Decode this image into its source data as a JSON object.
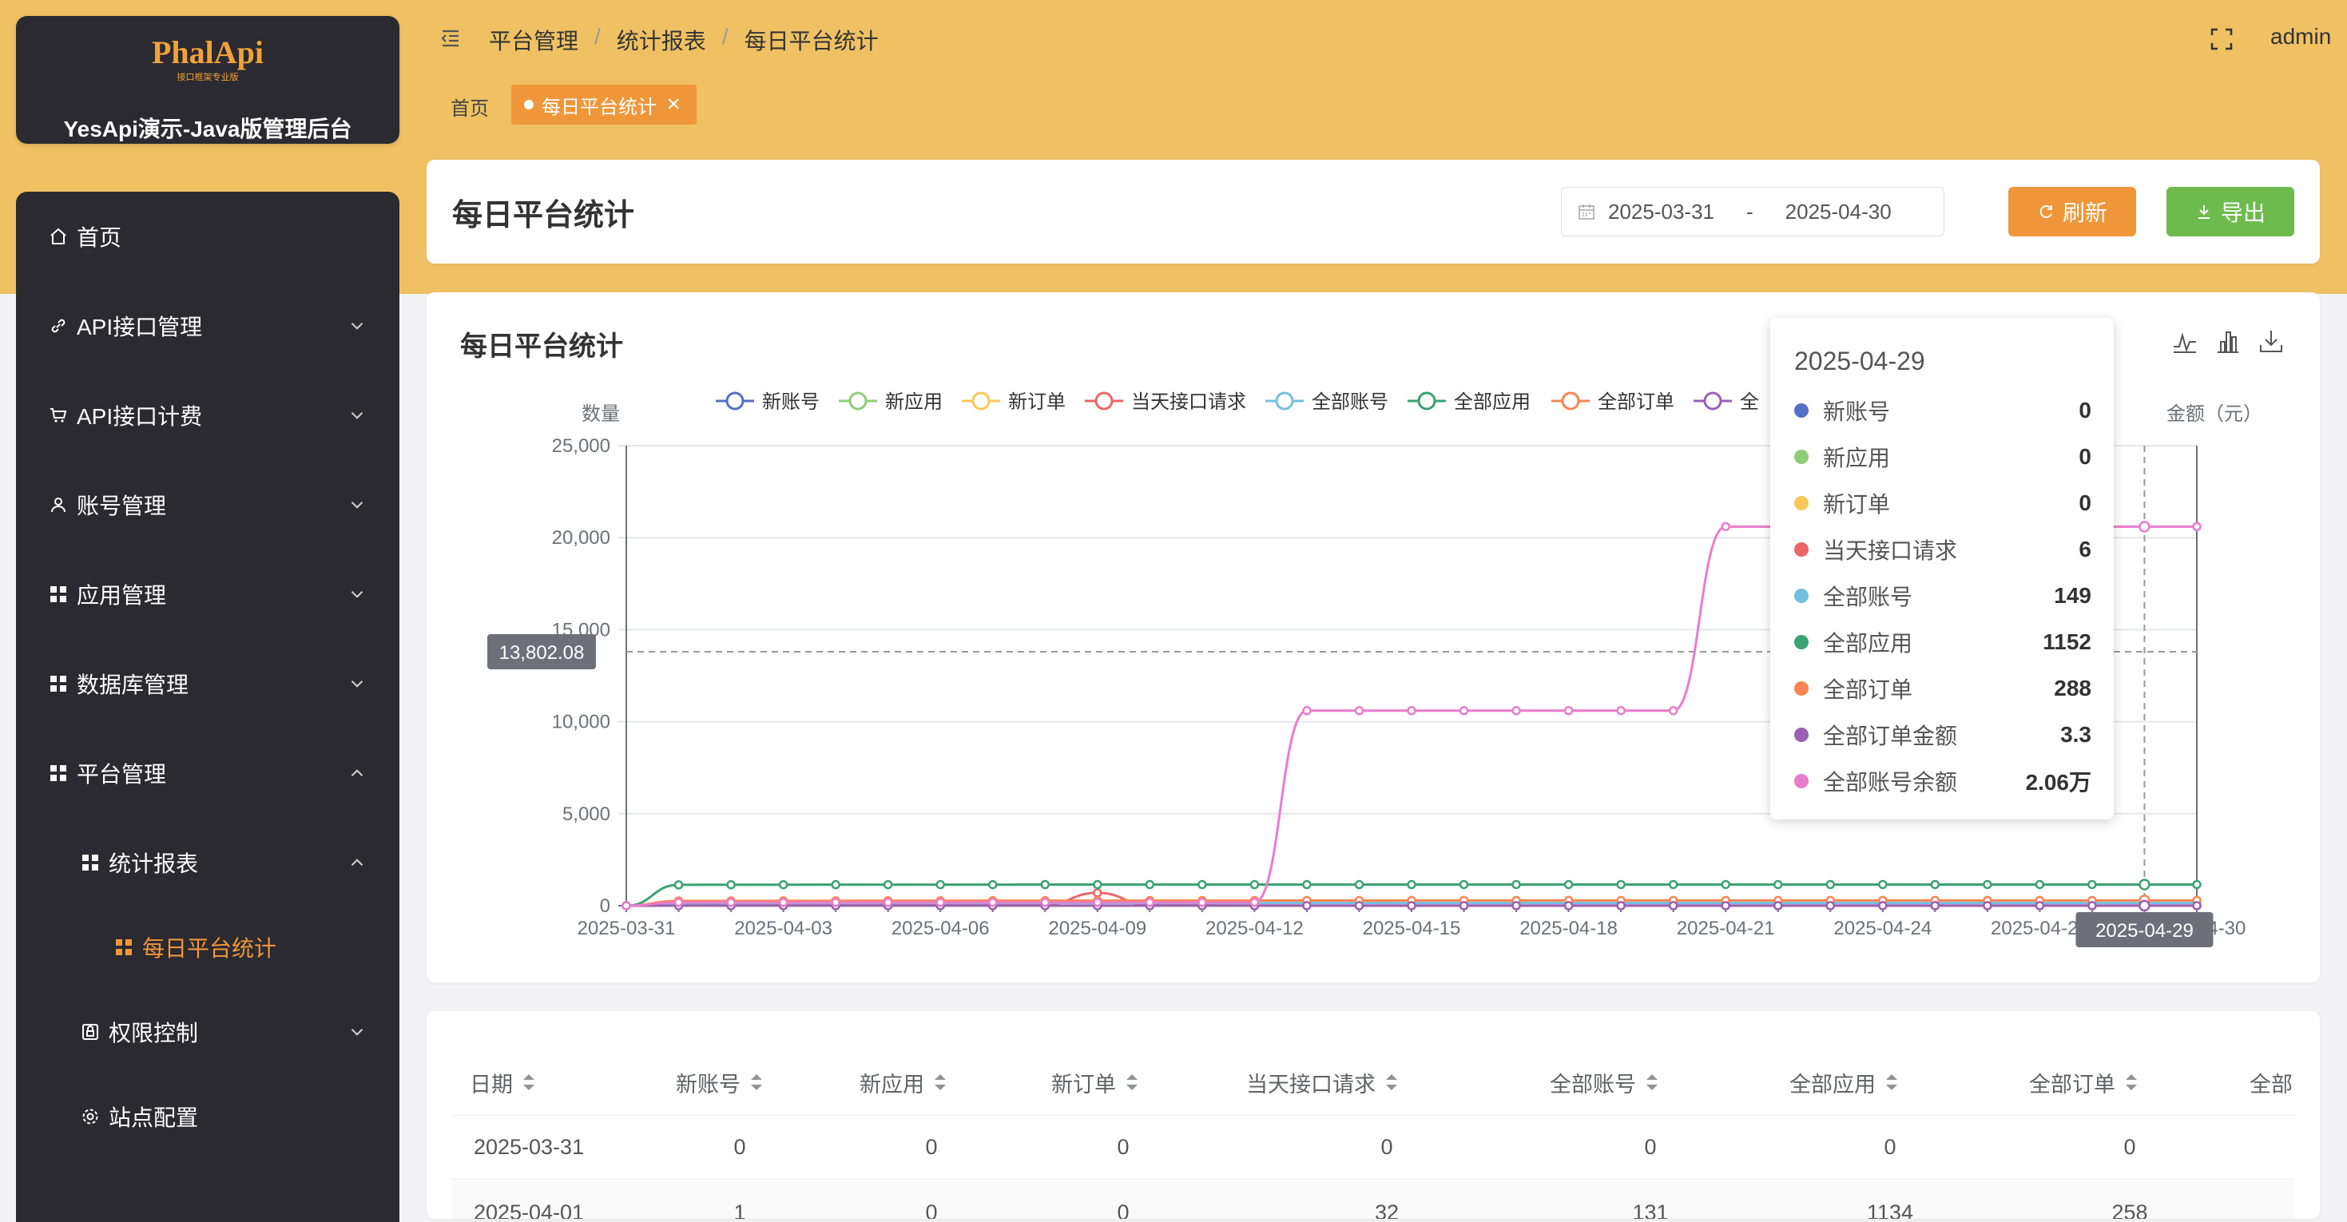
{
  "brand": {
    "logo": "PhalApi",
    "tagline": "接口框架专业版",
    "title": "YesApi演示-Java版管理后台"
  },
  "menu": {
    "home": "首页",
    "api_manage": "API接口管理",
    "api_billing": "API接口计费",
    "account": "账号管理",
    "app": "应用管理",
    "database": "数据库管理",
    "platform": "平台管理",
    "reports": "统计报表",
    "daily": "每日平台统计",
    "permission": "权限控制",
    "site": "站点配置"
  },
  "breadcrumb": [
    "平台管理",
    "统计报表",
    "每日平台统计"
  ],
  "user": "admin",
  "tabs": {
    "home": "首页",
    "active": "每日平台统计"
  },
  "header_card": {
    "title": "每日平台统计",
    "date_from": "2025-03-31",
    "date_sep": "-",
    "date_to": "2025-04-30",
    "refresh": "刷新",
    "export": "导出"
  },
  "chart_card": {
    "title": "每日平台统计",
    "y_left_label": "数量",
    "y_right_label": "金额（元）",
    "axis_pointer_y": "13,802.08",
    "axis_pointer_x": "2025-04-29"
  },
  "chart_data": {
    "type": "line",
    "title": "每日平台统计",
    "ylabel": "数量",
    "y2label": "金额（元）",
    "ylim": [
      0,
      25000
    ],
    "yticks": [
      "0",
      "5,000",
      "10,000",
      "15,000",
      "20,000",
      "25,000"
    ],
    "x": [
      "2025-03-31",
      "2025-04-01",
      "2025-04-02",
      "2025-04-03",
      "2025-04-04",
      "2025-04-05",
      "2025-04-06",
      "2025-04-07",
      "2025-04-08",
      "2025-04-09",
      "2025-04-10",
      "2025-04-11",
      "2025-04-12",
      "2025-04-13",
      "2025-04-14",
      "2025-04-15",
      "2025-04-16",
      "2025-04-17",
      "2025-04-18",
      "2025-04-19",
      "2025-04-20",
      "2025-04-21",
      "2025-04-22",
      "2025-04-23",
      "2025-04-24",
      "2025-04-25",
      "2025-04-26",
      "2025-04-27",
      "2025-04-28",
      "2025-04-29",
      "2025-04-30"
    ],
    "xticks": [
      "2025-03-31",
      "2025-04-03",
      "2025-04-06",
      "2025-04-09",
      "2025-04-12",
      "2025-04-15",
      "2025-04-18",
      "2025-04-21",
      "2025-04-24",
      "2025-04-27",
      "2025-04-30"
    ],
    "legend_position": "top",
    "grid": true,
    "series": [
      {
        "name": "新账号",
        "color": "#5470c6",
        "values": [
          0,
          1,
          0,
          0,
          0,
          0,
          0,
          0,
          0,
          0,
          0,
          0,
          0,
          0,
          0,
          0,
          0,
          0,
          0,
          0,
          0,
          0,
          0,
          0,
          0,
          0,
          0,
          0,
          0,
          0,
          0
        ]
      },
      {
        "name": "新应用",
        "color": "#91cc75",
        "values": [
          0,
          0,
          0,
          0,
          0,
          0,
          0,
          0,
          0,
          0,
          0,
          0,
          0,
          0,
          0,
          0,
          0,
          0,
          0,
          0,
          0,
          0,
          0,
          0,
          0,
          0,
          0,
          0,
          0,
          0,
          0
        ]
      },
      {
        "name": "新订单",
        "color": "#fac858",
        "values": [
          0,
          0,
          0,
          0,
          0,
          0,
          0,
          0,
          0,
          0,
          0,
          0,
          0,
          0,
          0,
          0,
          0,
          0,
          0,
          0,
          0,
          0,
          0,
          0,
          0,
          0,
          0,
          0,
          0,
          0,
          0
        ]
      },
      {
        "name": "当天接口请求",
        "color": "#ee6666",
        "values": [
          0,
          32,
          30,
          25,
          20,
          20,
          25,
          30,
          60,
          700,
          40,
          20,
          10,
          8,
          6,
          6,
          6,
          6,
          6,
          6,
          6,
          6,
          6,
          6,
          6,
          6,
          6,
          6,
          6,
          6,
          6
        ]
      },
      {
        "name": "全部账号",
        "color": "#73c0de",
        "values": [
          0,
          131,
          140,
          141,
          142,
          143,
          144,
          145,
          145,
          146,
          146,
          146,
          147,
          147,
          147,
          148,
          148,
          148,
          148,
          148,
          148,
          148,
          149,
          149,
          149,
          149,
          149,
          149,
          149,
          149,
          149
        ]
      },
      {
        "name": "全部应用",
        "color": "#3ba272",
        "values": [
          0,
          1134,
          1140,
          1142,
          1144,
          1145,
          1146,
          1147,
          1148,
          1148,
          1149,
          1149,
          1150,
          1150,
          1150,
          1150,
          1151,
          1151,
          1151,
          1151,
          1151,
          1151,
          1152,
          1152,
          1152,
          1152,
          1152,
          1152,
          1152,
          1152,
          1152
        ]
      },
      {
        "name": "全部订单",
        "color": "#fc8452",
        "values": [
          0,
          258,
          262,
          265,
          268,
          270,
          272,
          274,
          276,
          278,
          280,
          281,
          282,
          283,
          284,
          285,
          285,
          286,
          286,
          286,
          287,
          287,
          287,
          287,
          288,
          288,
          288,
          288,
          288,
          288,
          288
        ]
      },
      {
        "name": "全部订单金额",
        "color": "#9a60b4",
        "values": [
          0,
          3.3,
          3.3,
          3.3,
          3.3,
          3.3,
          3.3,
          3.3,
          3.3,
          3.3,
          3.3,
          3.3,
          3.3,
          3.3,
          3.3,
          3.3,
          3.3,
          3.3,
          3.3,
          3.3,
          3.3,
          3.3,
          3.3,
          3.3,
          3.3,
          3.3,
          3.3,
          3.3,
          3.3,
          3.3,
          3.3
        ]
      },
      {
        "name": "全部账号余额",
        "color": "#ea7ccc",
        "values": [
          0,
          180,
          180,
          180,
          180,
          180,
          180,
          180,
          180,
          180,
          180,
          180,
          180,
          10600,
          10600,
          10600,
          10600,
          10600,
          10600,
          10600,
          10600,
          20600,
          20600,
          20600,
          20600,
          20600,
          20600,
          20600,
          20600,
          20600,
          20600
        ]
      }
    ]
  },
  "legend_visible": [
    "新账号",
    "新应用",
    "新订单",
    "当天接口请求",
    "全部账号",
    "全部应用",
    "全部订单",
    "全"
  ],
  "tooltip": {
    "date": "2025-04-29",
    "rows": [
      {
        "name": "新账号",
        "value": "0",
        "color": "#5470c6"
      },
      {
        "name": "新应用",
        "value": "0",
        "color": "#91cc75"
      },
      {
        "name": "新订单",
        "value": "0",
        "color": "#fac858"
      },
      {
        "name": "当天接口请求",
        "value": "6",
        "color": "#ee6666"
      },
      {
        "name": "全部账号",
        "value": "149",
        "color": "#73c0de"
      },
      {
        "name": "全部应用",
        "value": "1152",
        "color": "#3ba272"
      },
      {
        "name": "全部订单",
        "value": "288",
        "color": "#fc8452"
      },
      {
        "name": "全部订单金额",
        "value": "3.3",
        "color": "#9a60b4"
      },
      {
        "name": "全部账号余额",
        "value": "2.06万",
        "color": "#ea7ccc"
      }
    ]
  },
  "table": {
    "headers": [
      "日期",
      "新账号",
      "新应用",
      "新订单",
      "当天接口请求",
      "全部账号",
      "全部应用",
      "全部订单",
      "全部"
    ],
    "rows": [
      [
        "2025-03-31",
        "0",
        "0",
        "0",
        "0",
        "0",
        "0",
        "0"
      ],
      [
        "2025-04-01",
        "1",
        "0",
        "0",
        "32",
        "131",
        "1134",
        "258"
      ]
    ]
  }
}
